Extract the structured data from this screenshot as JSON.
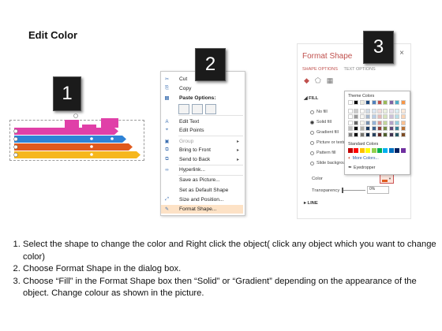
{
  "title": "Edit Color",
  "badges": [
    "1",
    "2",
    "3"
  ],
  "arrow_colors": [
    "#e040a8",
    "#2e83d6",
    "#e05a1d",
    "#f6b71d"
  ],
  "menu": {
    "items": [
      {
        "label": "Cut",
        "icon": "scissors-icon",
        "glyph": "✂",
        "disabled": false,
        "submenu": false
      },
      {
        "label": "Copy",
        "icon": "copy-icon",
        "glyph": "⎘",
        "disabled": false,
        "submenu": false
      },
      {
        "label": "Paste Options:",
        "icon": "paste-icon",
        "glyph": "📋",
        "disabled": false,
        "submenu": false,
        "bold": true
      },
      {
        "label": "Edit Text",
        "icon": "edit-text-icon",
        "glyph": "A",
        "disabled": false,
        "submenu": false
      },
      {
        "label": "Edit Points",
        "icon": "edit-points-icon",
        "glyph": "⌖",
        "disabled": false,
        "submenu": false
      },
      {
        "label": "Group",
        "icon": "group-icon",
        "glyph": "▣",
        "disabled": true,
        "submenu": true
      },
      {
        "label": "Bring to Front",
        "icon": "bring-front-icon",
        "glyph": "⧉",
        "disabled": false,
        "submenu": true
      },
      {
        "label": "Send to Back",
        "icon": "send-back-icon",
        "glyph": "⧉",
        "disabled": false,
        "submenu": true
      },
      {
        "label": "Hyperlink...",
        "icon": "hyperlink-icon",
        "glyph": "🔗",
        "disabled": false,
        "submenu": false
      },
      {
        "label": "Save as Picture...",
        "icon": "",
        "glyph": "",
        "disabled": false,
        "submenu": false
      },
      {
        "label": "Set as Default Shape",
        "icon": "",
        "glyph": "",
        "disabled": false,
        "submenu": false
      },
      {
        "label": "Size and Position...",
        "icon": "size-position-icon",
        "glyph": "⤢",
        "disabled": false,
        "submenu": false
      },
      {
        "label": "Format Shape...",
        "icon": "format-shape-icon",
        "glyph": "🖌",
        "disabled": false,
        "submenu": false,
        "highlighted": true
      }
    ]
  },
  "pane": {
    "title": "Format Shape",
    "close": "×",
    "tab_active": "SHAPE OPTIONS",
    "tab_inactive": "TEXT OPTIONS",
    "fill_section": "FILL",
    "fill_options": [
      "No fill",
      "Solid fill",
      "Gradient fill",
      "Picture or textu",
      "Pattern fill",
      "Slide backgrou"
    ],
    "selected_fill": 1,
    "color_label": "Color",
    "transparency_label": "Transparency",
    "transparency_value": "0%",
    "line_section": "LINE",
    "color_swatch": "#e05a1d"
  },
  "palette": {
    "theme_title": "Theme Colors",
    "theme_top": [
      "#ffffff",
      "#000000",
      "#eeece1",
      "#1f497d",
      "#4f81bd",
      "#c0504d",
      "#9bbb59",
      "#8064a2",
      "#4bacc6",
      "#f79646"
    ],
    "standard_title": "Standard Colors",
    "standard": [
      "#c00000",
      "#ff0000",
      "#ffc000",
      "#ffff00",
      "#92d050",
      "#00b050",
      "#00b0f0",
      "#0070c0",
      "#002060",
      "#7030a0"
    ],
    "more_colors": "More Colors...",
    "eyedropper": "Eyedropper"
  },
  "instructions": [
    "Select the shape to change the color and Right click the object( click any object which you want to change color)",
    "Choose Format Shape in the dialog box.",
    "Choose “Fill” in the Format Shape box then “Solid” or “Gradient” depending on the appearance of the object. Change colour as shown in the picture."
  ]
}
